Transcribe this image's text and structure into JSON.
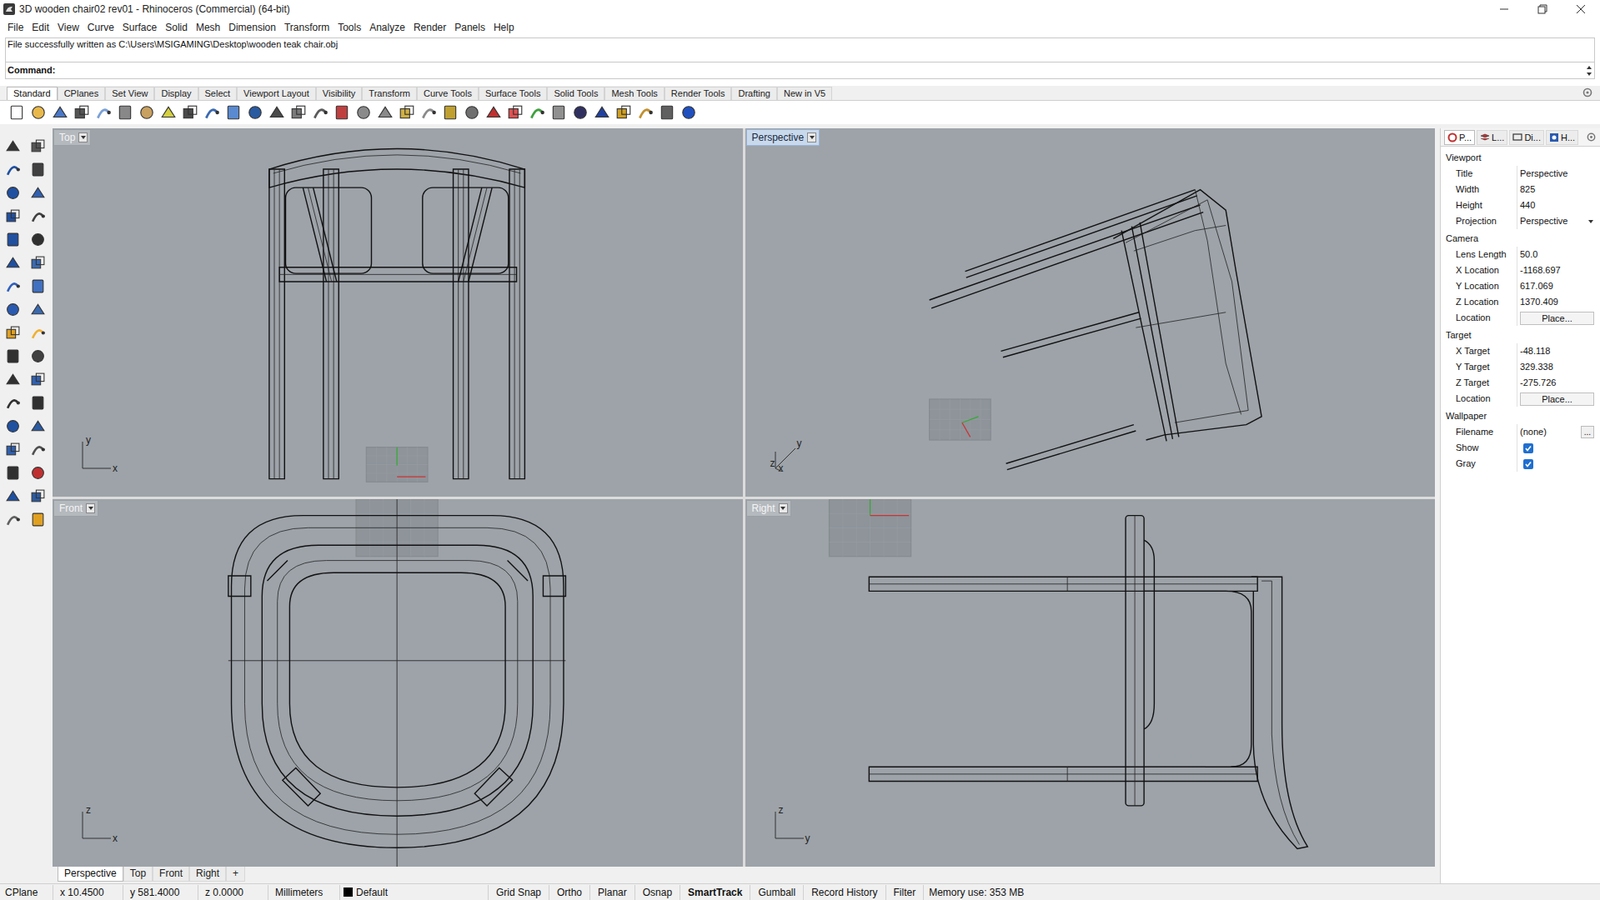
{
  "window": {
    "title": "3D wooden chair02 rev01 - Rhinoceros (Commercial) (64-bit)"
  },
  "menu": [
    "File",
    "Edit",
    "View",
    "Curve",
    "Surface",
    "Solid",
    "Mesh",
    "Dimension",
    "Transform",
    "Tools",
    "Analyze",
    "Render",
    "Panels",
    "Help"
  ],
  "command_history": "File successfully written as C:\\Users\\MSIGAMING\\Desktop\\wooden teak chair.obj",
  "command_prompt": "Command:",
  "toolbar_tabs": [
    {
      "label": "Standard",
      "selected": true
    },
    {
      "label": "CPlanes",
      "selected": false
    },
    {
      "label": "Set View",
      "selected": false
    },
    {
      "label": "Display",
      "selected": false
    },
    {
      "label": "Select",
      "selected": false
    },
    {
      "label": "Viewport Layout",
      "selected": false
    },
    {
      "label": "Visibility",
      "selected": false
    },
    {
      "label": "Transform",
      "selected": false
    },
    {
      "label": "Curve Tools",
      "selected": false
    },
    {
      "label": "Surface Tools",
      "selected": false
    },
    {
      "label": "Solid Tools",
      "selected": false
    },
    {
      "label": "Mesh Tools",
      "selected": false
    },
    {
      "label": "Render Tools",
      "selected": false
    },
    {
      "label": "Drafting",
      "selected": false
    },
    {
      "label": "New in V5",
      "selected": false
    }
  ],
  "viewports": [
    {
      "label": "Top",
      "active": false,
      "axes": [
        "y",
        "x"
      ]
    },
    {
      "label": "Perspective",
      "active": true,
      "axes": [
        "y",
        "z",
        "x"
      ]
    },
    {
      "label": "Front",
      "active": false,
      "axes": [
        "z",
        "x"
      ]
    },
    {
      "label": "Right",
      "active": false,
      "axes": [
        "z",
        "y"
      ]
    }
  ],
  "viewport_tabs": [
    {
      "label": "Perspective",
      "selected": true
    },
    {
      "label": "Top",
      "selected": false
    },
    {
      "label": "Front",
      "selected": false
    },
    {
      "label": "Right",
      "selected": false
    },
    {
      "label": "+",
      "selected": false
    }
  ],
  "properties": {
    "tabs": [
      {
        "label": "P...",
        "selected": true
      },
      {
        "label": "L...",
        "selected": false
      },
      {
        "label": "Di...",
        "selected": false
      },
      {
        "label": "H...",
        "selected": false
      }
    ],
    "sections": [
      {
        "title": "Viewport",
        "rows": [
          {
            "label": "Title",
            "value": "Perspective",
            "kind": "text"
          },
          {
            "label": "Width",
            "value": "825",
            "kind": "text"
          },
          {
            "label": "Height",
            "value": "440",
            "kind": "text"
          },
          {
            "label": "Projection",
            "value": "Perspective",
            "kind": "dropdown"
          }
        ]
      },
      {
        "title": "Camera",
        "rows": [
          {
            "label": "Lens Length",
            "value": "50.0",
            "kind": "text"
          },
          {
            "label": "X Location",
            "value": "-1168.697",
            "kind": "text"
          },
          {
            "label": "Y Location",
            "value": "617.069",
            "kind": "text"
          },
          {
            "label": "Z Location",
            "value": "1370.409",
            "kind": "text"
          },
          {
            "label": "Location",
            "value": "Place...",
            "kind": "button"
          }
        ]
      },
      {
        "title": "Target",
        "rows": [
          {
            "label": "X Target",
            "value": "-48.118",
            "kind": "text"
          },
          {
            "label": "Y Target",
            "value": "329.338",
            "kind": "text"
          },
          {
            "label": "Z Target",
            "value": "-275.726",
            "kind": "text"
          },
          {
            "label": "Location",
            "value": "Place...",
            "kind": "button"
          }
        ]
      },
      {
        "title": "Wallpaper",
        "rows": [
          {
            "label": "Filename",
            "value": "(none)",
            "kind": "file",
            "button": "..."
          },
          {
            "label": "Show",
            "checked": true,
            "kind": "checkbox"
          },
          {
            "label": "Gray",
            "checked": true,
            "kind": "checkbox"
          }
        ]
      }
    ]
  },
  "status_bar": {
    "cplane": "CPlane",
    "x": "x 10.4500",
    "y": "y 581.4000",
    "z": "z 0.0000",
    "units": "Millimeters",
    "layer": "Default",
    "toggles": [
      {
        "label": "Grid Snap",
        "on": false
      },
      {
        "label": "Ortho",
        "on": false
      },
      {
        "label": "Planar",
        "on": false
      },
      {
        "label": "Osnap",
        "on": false
      },
      {
        "label": "SmartTrack",
        "on": true
      },
      {
        "label": "Gumball",
        "on": false
      },
      {
        "label": "Record History",
        "on": false
      },
      {
        "label": "Filter",
        "on": false
      }
    ],
    "memory": "Memory use: 353 MB"
  }
}
